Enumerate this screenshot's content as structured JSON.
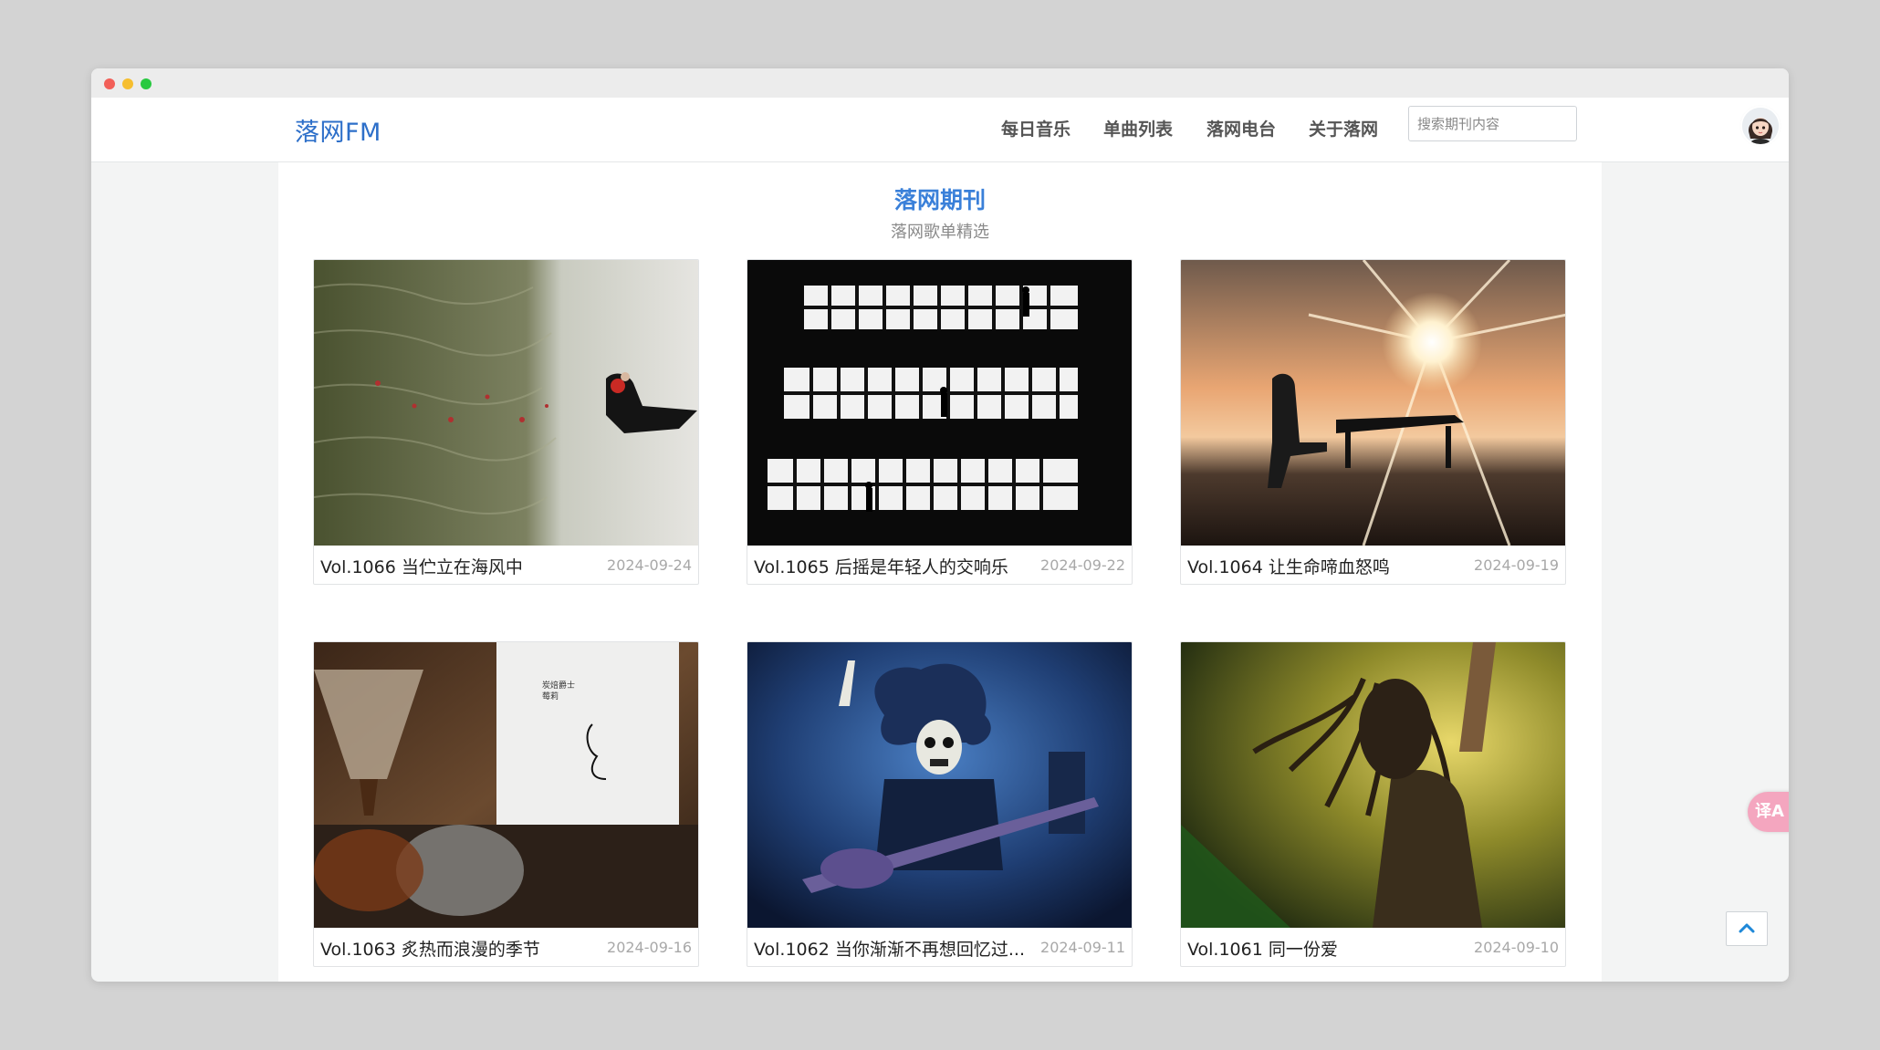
{
  "site": {
    "brand": "落网FM"
  },
  "nav": {
    "items": [
      {
        "label": "每日音乐"
      },
      {
        "label": "单曲列表"
      },
      {
        "label": "落网电台"
      },
      {
        "label": "关于落网"
      }
    ],
    "search_placeholder": "搜索期刊内容"
  },
  "header": {
    "title": "落网期刊",
    "subtitle": "落网歌单精选"
  },
  "volumes": [
    {
      "title": "Vol.1066 当伫立在海风中",
      "date": "2024-09-24",
      "image": "woman-in-black-dress-on-shoreline"
    },
    {
      "title": "Vol.1065 后摇是年轻人的交响乐",
      "date": "2024-09-22",
      "image": "silhouettes-in-window-grid"
    },
    {
      "title": "Vol.1064 让生命啼血怒鸣",
      "date": "2024-09-19",
      "image": "piano-on-beach-at-sunset"
    },
    {
      "title": "Vol.1063 炙热而浪漫的季节",
      "date": "2024-09-16",
      "image": "coffee-pour-over-and-bag"
    },
    {
      "title": "Vol.1062 当你渐渐不再想回忆过...",
      "date": "2024-09-11",
      "image": "skeleton-guitarist"
    },
    {
      "title": "Vol.1061 同一份爱",
      "date": "2024-09-10",
      "image": "dreadlocked-singer-on-stage"
    }
  ],
  "widgets": {
    "translate_label": "译A",
    "back_to_top_icon": "chevron-up-icon"
  },
  "colors": {
    "accent": "#3a80d9",
    "brand": "#2d6fc9",
    "translate_bg": "#f4a6bf"
  }
}
